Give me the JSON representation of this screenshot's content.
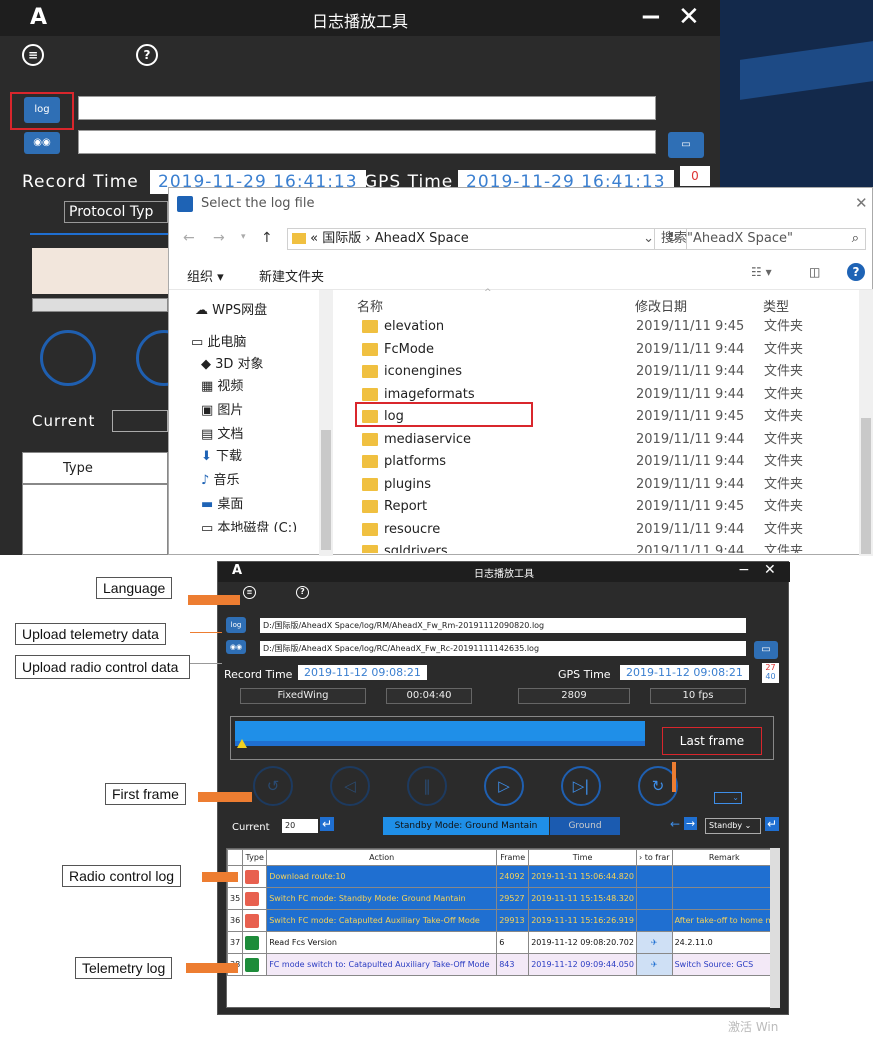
{
  "app_title": "日志播放工具",
  "top_app": {
    "record_time_label": "Record Time",
    "record_time_value": "2019-11-29 16:41:13",
    "gps_time_label": "GPS Time",
    "gps_time_value": "2019-11-29 16:41:13",
    "gps_badge": "0",
    "protocol_label": "Protocol Typ",
    "current_label": "Current",
    "type_header": "Type",
    "log_icon_text": "log"
  },
  "dialog": {
    "title": "Select the log file",
    "breadcrumb": [
      "«",
      "国际版",
      "›",
      "AheadX Space"
    ],
    "search_placeholder": "搜索\"AheadX Space\"",
    "toolbar": {
      "organize": "组织 ▾",
      "new_folder": "新建文件夹"
    },
    "columns": {
      "name": "名称",
      "date": "修改日期",
      "type": "类型"
    },
    "nav": [
      "WPS网盘",
      "此电脑",
      "3D 对象",
      "视频",
      "图片",
      "文档",
      "下载",
      "音乐",
      "桌面",
      "本地磁盘 (C:)"
    ],
    "files": [
      {
        "name": "elevation",
        "date": "2019/11/11 9:45",
        "type": "文件夹"
      },
      {
        "name": "FcMode",
        "date": "2019/11/11 9:44",
        "type": "文件夹"
      },
      {
        "name": "iconengines",
        "date": "2019/11/11 9:44",
        "type": "文件夹"
      },
      {
        "name": "imageformats",
        "date": "2019/11/11 9:44",
        "type": "文件夹"
      },
      {
        "name": "log",
        "date": "2019/11/11 9:45",
        "type": "文件夹"
      },
      {
        "name": "mediaservice",
        "date": "2019/11/11 9:44",
        "type": "文件夹"
      },
      {
        "name": "platforms",
        "date": "2019/11/11 9:44",
        "type": "文件夹"
      },
      {
        "name": "plugins",
        "date": "2019/11/11 9:44",
        "type": "文件夹"
      },
      {
        "name": "Report",
        "date": "2019/11/11 9:45",
        "type": "文件夹"
      },
      {
        "name": "resoucre",
        "date": "2019/11/11 9:44",
        "type": "文件夹"
      },
      {
        "name": "sqldrivers",
        "date": "2019/11/11 9:44",
        "type": "文件夹"
      }
    ]
  },
  "player": {
    "telemetry_path": "D:/国际版/AheadX Space/log/RM/AheadX_Fw_Rm-20191112090820.log",
    "rc_path": "D:/国际版/AheadX Space/log/RC/AheadX_Fw_Rc-20191111142635.log",
    "record_time_label": "Record Time",
    "record_time_value": "2019-11-12 09:08:21",
    "gps_time_label": "GPS Time",
    "gps_time_value": "2019-11-12 09:08:21",
    "gps_badge_top": "27",
    "gps_badge_bottom": "40",
    "aircraft_type": "FixedWing",
    "duration": "00:04:40",
    "frame_count": "2809",
    "fps": "10 fps",
    "last_frame_label": "Last frame",
    "progress": 0.03,
    "current_label": "Current",
    "current_value": "20",
    "mode_label": "Standby Mode: Ground Mantain",
    "ground_label": "Ground",
    "standby_select": "Standby",
    "table_headers": [
      "Type",
      "Action",
      "Frame",
      "Time",
      "› to frar",
      "Remark"
    ],
    "rows": [
      {
        "num": "",
        "action": "Download route:10",
        "frame": "24092",
        "time": "2019-11-11 15:06:44.820",
        "remark": "",
        "style": "b",
        "kind": "rc"
      },
      {
        "num": "35",
        "action": "Switch FC mode: Standby Mode: Ground Mantain",
        "frame": "29527",
        "time": "2019-11-11 15:15:48.320",
        "remark": "",
        "style": "b",
        "kind": "rc"
      },
      {
        "num": "36",
        "action": "Switch FC mode: Catapulted Auxiliary Take-Off Mode",
        "frame": "29913",
        "time": "2019-11-11 15:16:26.919",
        "remark": "After take-off to home m",
        "style": "b",
        "kind": "rc"
      },
      {
        "num": "37",
        "action": "Read Fcs Version",
        "frame": "6",
        "time": "2019-11-12 09:08:20.702",
        "remark": "24.2.11.0",
        "style": "w",
        "kind": "tm"
      },
      {
        "num": "38",
        "action": "FC mode switch to: Catapulted Auxiliary Take-Off Mode",
        "frame": "843",
        "time": "2019-11-12 09:09:44.050",
        "remark": "Switch Source: GCS",
        "style": "p",
        "kind": "tm"
      }
    ]
  },
  "callouts": {
    "language": "Language",
    "upload_telemetry": "Upload telemetry data",
    "upload_rc": "Upload radio control data",
    "first_frame": "First frame",
    "rc_log": "Radio control log",
    "telemetry_log": "Telemetry log"
  },
  "watermark": "激活 Win",
  "colors": {
    "accent_blue": "#1f6fd1",
    "callout_orange": "#ed7d31",
    "highlight_red": "#d9262c"
  }
}
